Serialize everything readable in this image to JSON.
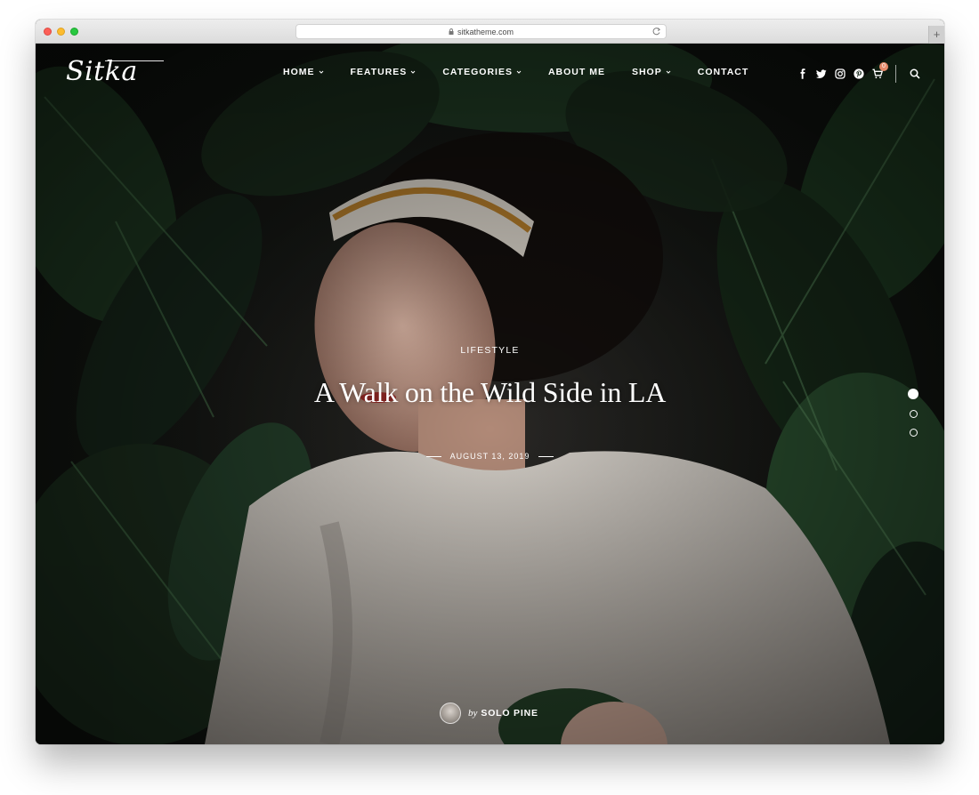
{
  "browser": {
    "url": "sitkatheme.com",
    "new_tab_glyph": "+"
  },
  "site": {
    "logo_text": "Sitka"
  },
  "nav": {
    "items": [
      {
        "label": "HOME",
        "has_dropdown": true
      },
      {
        "label": "FEATURES",
        "has_dropdown": true
      },
      {
        "label": "CATEGORIES",
        "has_dropdown": true
      },
      {
        "label": "ABOUT ME",
        "has_dropdown": false
      },
      {
        "label": "SHOP",
        "has_dropdown": true
      },
      {
        "label": "CONTACT",
        "has_dropdown": false
      }
    ]
  },
  "header_icons": {
    "social": [
      "facebook-icon",
      "twitter-icon",
      "instagram-icon",
      "pinterest-icon"
    ],
    "cart_count": "0",
    "search": "search-icon"
  },
  "hero": {
    "category": "LIFESTYLE",
    "title": "A Walk on the Wild Side in LA",
    "date": "AUGUST 13, 2019",
    "author_prefix": "by",
    "author_name": "SOLO PINE"
  },
  "slider": {
    "total": 3,
    "active_index": 0
  },
  "colors": {
    "badge": "#e58a6a",
    "text": "#ffffff"
  }
}
